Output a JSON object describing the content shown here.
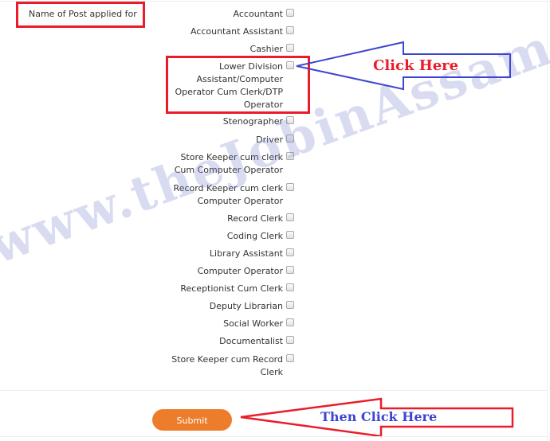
{
  "form": {
    "field_label": "Name of Post applied for",
    "options": [
      {
        "label_lines": [
          "Accountant"
        ],
        "checked": false
      },
      {
        "label_lines": [
          "Accountant Assistant"
        ],
        "checked": false
      },
      {
        "label_lines": [
          "Cashier"
        ],
        "checked": false
      },
      {
        "label_lines": [
          "Lower Division",
          "Assistant/Computer",
          "Operator Cum Clerk/DTP",
          "Operator"
        ],
        "checked": false,
        "highlighted": true
      },
      {
        "label_lines": [
          "Stenographer"
        ],
        "checked": false
      },
      {
        "label_lines": [
          "Driver"
        ],
        "checked": false
      },
      {
        "label_lines": [
          "Store Keeper cum clerk",
          "Cum Computer Operator"
        ],
        "checked": false
      },
      {
        "label_lines": [
          "Record Keeper cum clerk",
          "Computer Operator"
        ],
        "checked": false
      },
      {
        "label_lines": [
          "Record Clerk"
        ],
        "checked": false
      },
      {
        "label_lines": [
          "Coding Clerk"
        ],
        "checked": false
      },
      {
        "label_lines": [
          "Library Assistant"
        ],
        "checked": false
      },
      {
        "label_lines": [
          "Computer Operator"
        ],
        "checked": false
      },
      {
        "label_lines": [
          "Receptionist Cum Clerk"
        ],
        "checked": false
      },
      {
        "label_lines": [
          "Deputy Librarian"
        ],
        "checked": false
      },
      {
        "label_lines": [
          "Social Worker"
        ],
        "checked": false
      },
      {
        "label_lines": [
          "Documentalist"
        ],
        "checked": false
      },
      {
        "label_lines": [
          "Store Keeper cum Record",
          "Clerk"
        ],
        "checked": false
      }
    ],
    "submit_label": "Submit"
  },
  "annotations": {
    "arrow1_text": "Click Here",
    "arrow2_text": "Then Click Here",
    "watermark": "www.theJobinAssam.in",
    "colors": {
      "red": "#ea1c2b",
      "blue": "#3d45d0",
      "submit_orange": "#ee7d2b"
    }
  }
}
